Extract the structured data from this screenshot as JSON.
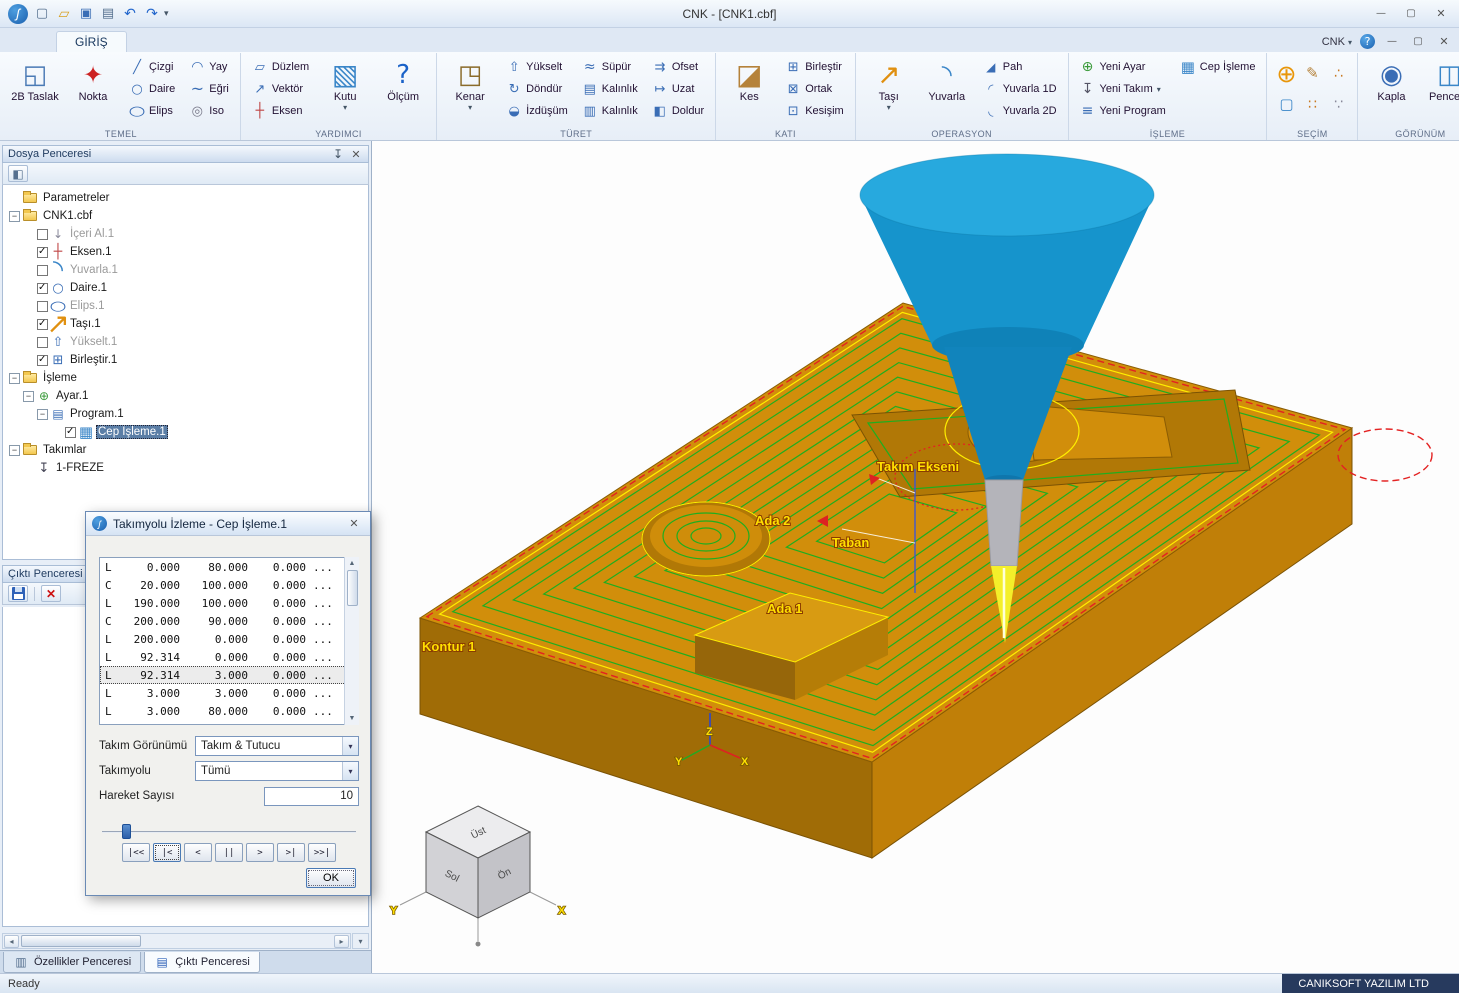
{
  "titlebar": {
    "title": "CNK - [CNK1.cbf]",
    "qat": [
      "new",
      "open",
      "save",
      "print",
      "undo",
      "redo"
    ]
  },
  "ribbon": {
    "tab": "GİRİŞ",
    "window_menu": "CNK",
    "help": "?",
    "groups": [
      {
        "label": "TEMEL",
        "items": [
          {
            "type": "large",
            "label": "2B Taslak",
            "icon": "sketch-2d"
          },
          {
            "type": "large",
            "label": "Nokta",
            "icon": "point"
          },
          {
            "type": "col",
            "buttons": [
              {
                "label": "Çizgi",
                "icon": "line"
              },
              {
                "label": "Daire",
                "icon": "circle"
              },
              {
                "label": "Elips",
                "icon": "ellipse"
              }
            ]
          },
          {
            "type": "col",
            "buttons": [
              {
                "label": "Yay",
                "icon": "arc"
              },
              {
                "label": "Eğri",
                "icon": "curve"
              },
              {
                "label": "Iso",
                "icon": "iso"
              }
            ]
          }
        ]
      },
      {
        "label": "YARDIMCI",
        "items": [
          {
            "type": "col",
            "buttons": [
              {
                "label": "Düzlem",
                "icon": "plane"
              },
              {
                "label": "Vektör",
                "icon": "vector"
              },
              {
                "label": "Eksen",
                "icon": "axis"
              }
            ]
          },
          {
            "type": "large",
            "label": "Kutu",
            "icon": "box",
            "dd": true
          },
          {
            "type": "large",
            "label": "Ölçüm",
            "icon": "measure"
          }
        ]
      },
      {
        "label": "TÜRET",
        "items": [
          {
            "type": "large",
            "label": "Kenar",
            "icon": "edge",
            "dd": true
          },
          {
            "type": "col",
            "buttons": [
              {
                "label": "Yükselt",
                "icon": "extrude"
              },
              {
                "label": "Döndür",
                "icon": "revolve"
              },
              {
                "label": "İzdüşüm",
                "icon": "project"
              }
            ]
          },
          {
            "type": "col",
            "buttons": [
              {
                "label": "Süpür",
                "icon": "sweep"
              },
              {
                "label": "Kalınlık",
                "icon": "thickness"
              },
              {
                "label": "Kalınlık",
                "icon": "thickness2"
              }
            ]
          },
          {
            "type": "col",
            "buttons": [
              {
                "label": "Ofset",
                "icon": "offset"
              },
              {
                "label": "Uzat",
                "icon": "extend"
              },
              {
                "label": "Doldur",
                "icon": "fill"
              }
            ]
          }
        ]
      },
      {
        "label": "KATI",
        "items": [
          {
            "type": "large",
            "label": "Kes",
            "icon": "cut"
          },
          {
            "type": "col",
            "buttons": [
              {
                "label": "Birleştir",
                "icon": "union"
              },
              {
                "label": "Ortak",
                "icon": "common"
              },
              {
                "label": "Kesişim",
                "icon": "intersect"
              }
            ]
          }
        ]
      },
      {
        "label": "OPERASYON",
        "items": [
          {
            "type": "large",
            "label": "Taşı",
            "icon": "move",
            "dd": true
          },
          {
            "type": "large",
            "label": "Yuvarla",
            "icon": "fillet"
          },
          {
            "type": "col",
            "buttons": [
              {
                "label": "Pah",
                "icon": "chamfer"
              },
              {
                "label": "Yuvarla 1D",
                "icon": "fillet1d"
              },
              {
                "label": "Yuvarla 2D",
                "icon": "fillet2d"
              }
            ]
          }
        ]
      },
      {
        "label": "İŞLEME",
        "items": [
          {
            "type": "col",
            "buttons": [
              {
                "label": "Yeni Ayar",
                "icon": "new-setup"
              },
              {
                "label": "Yeni Takım",
                "icon": "new-tool",
                "dd": true
              },
              {
                "label": "Yeni Program",
                "icon": "new-program"
              }
            ]
          },
          {
            "type": "col",
            "buttons": [
              {
                "label": "Cep İşleme",
                "icon": "pocket"
              }
            ]
          }
        ]
      },
      {
        "label": "SEÇİM",
        "items": [
          {
            "type": "grid",
            "icons": [
              "target",
              "pencil",
              "dots",
              "marquee",
              "grid-dots",
              "dots2"
            ]
          }
        ]
      },
      {
        "label": "GÖRÜNÜM",
        "items": [
          {
            "type": "large",
            "label": "Kapla",
            "icon": "magnify"
          },
          {
            "type": "large",
            "label": "Pencere",
            "icon": "window"
          }
        ]
      }
    ]
  },
  "sidebar": {
    "file_panel": {
      "title": "Dosya Penceresi"
    },
    "output_panel": {
      "title": "Çıktı Penceresi"
    },
    "tree": [
      {
        "indent": 0,
        "icon": "folder",
        "label": "Parametreler"
      },
      {
        "indent": 0,
        "exp": true,
        "icon": "folder",
        "label": "CNK1.cbf"
      },
      {
        "indent": 1,
        "check": "off",
        "icon": "import",
        "label": "İçeri Al.1",
        "gray": true
      },
      {
        "indent": 1,
        "check": "on",
        "icon": "axis",
        "label": "Eksen.1"
      },
      {
        "indent": 1,
        "check": "off",
        "icon": "fillet",
        "label": "Yuvarla.1",
        "gray": true
      },
      {
        "indent": 1,
        "check": "on",
        "icon": "circle",
        "label": "Daire.1"
      },
      {
        "indent": 1,
        "check": "off",
        "icon": "ellipse",
        "label": "Elips.1",
        "gray": true
      },
      {
        "indent": 1,
        "check": "on",
        "icon": "move",
        "label": "Taşı.1"
      },
      {
        "indent": 1,
        "check": "off",
        "icon": "extrude",
        "label": "Yükselt.1",
        "gray": true
      },
      {
        "indent": 1,
        "check": "on",
        "icon": "union",
        "label": "Birleştir.1"
      },
      {
        "indent": 0,
        "exp": true,
        "icon": "folder",
        "label": "İşleme"
      },
      {
        "indent": 1,
        "exp": true,
        "icon": "setup",
        "label": "Ayar.1"
      },
      {
        "indent": 2,
        "exp": true,
        "icon": "program",
        "label": "Program.1"
      },
      {
        "indent": 3,
        "check": "on",
        "icon": "pocket",
        "label": "Cep İşleme.1",
        "selected": true
      },
      {
        "indent": 0,
        "exp": true,
        "icon": "folder",
        "label": "Takımlar"
      },
      {
        "indent": 1,
        "icon": "tool",
        "label": "1-FREZE"
      }
    ],
    "tabs": [
      {
        "label": "Özellikler Penceresi",
        "icon": "prop-tab"
      },
      {
        "label": "Çıktı Penceresi",
        "icon": "out-tab",
        "active": true
      }
    ]
  },
  "dialog": {
    "title": "Takımyolu İzleme - Cep İşleme.1",
    "rows": [
      {
        "c": "L",
        "x": "0.000",
        "y": "80.000",
        "z": "0.000"
      },
      {
        "c": "C",
        "x": "20.000",
        "y": "100.000",
        "z": "0.000"
      },
      {
        "c": "L",
        "x": "190.000",
        "y": "100.000",
        "z": "0.000"
      },
      {
        "c": "C",
        "x": "200.000",
        "y": "90.000",
        "z": "0.000"
      },
      {
        "c": "L",
        "x": "200.000",
        "y": "0.000",
        "z": "0.000"
      },
      {
        "c": "L",
        "x": "92.314",
        "y": "0.000",
        "z": "0.000"
      },
      {
        "c": "L",
        "x": "92.314",
        "y": "3.000",
        "z": "0.000",
        "hl": true
      },
      {
        "c": "L",
        "x": "3.000",
        "y": "3.000",
        "z": "0.000"
      },
      {
        "c": "L",
        "x": "3.000",
        "y": "80.000",
        "z": "0.000"
      }
    ],
    "ellipsis": "...",
    "fields": [
      {
        "label": "Takım Görünümü",
        "value": "Takım & Tutucu",
        "type": "select"
      },
      {
        "label": "Takımyolu",
        "value": "Tümü",
        "type": "select"
      },
      {
        "label": "Hareket Sayısı",
        "value": "10",
        "type": "input"
      }
    ],
    "playback": [
      "|<<",
      "|<",
      "<",
      "||",
      ">",
      ">|",
      ">>|"
    ],
    "ok": "OK"
  },
  "viewport": {
    "labels": {
      "takim_ekseni": "Takım Ekseni",
      "ada2": "Ada 2",
      "taban": "Taban",
      "ada1": "Ada 1",
      "kontur1": "Kontur 1",
      "axis_z": "Z",
      "axis_y": "Y",
      "axis_x": "X",
      "cube_top": "Üst",
      "cube_left": "Sol",
      "cube_front": "Ön",
      "cube_y": "Y",
      "cube_x": "X"
    },
    "colors": {
      "stock": "#d18e0b",
      "toolpath": "#1fae1f",
      "tool": "#1899d6",
      "highlight": "#ffee00"
    }
  },
  "statusbar": {
    "left": "Ready",
    "right": "CANIKSOFT YAZILIM LTD"
  }
}
